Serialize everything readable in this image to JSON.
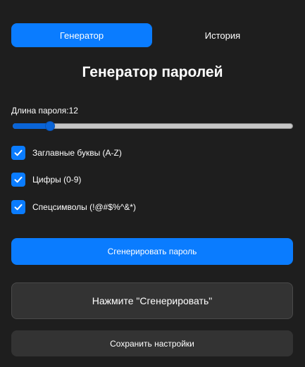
{
  "tabs": [
    {
      "label": "Генератор",
      "active": true
    },
    {
      "label": "История",
      "active": false
    }
  ],
  "title": "Генератор паролей",
  "length": {
    "label": "Длина пароля:",
    "value": "12",
    "min": 4,
    "max": 64
  },
  "options": [
    {
      "label": "Заглавные буквы (A-Z)",
      "checked": true
    },
    {
      "label": "Цифры (0-9)",
      "checked": true
    },
    {
      "label": "Спецсимволы (!@#$%^&*)",
      "checked": true
    }
  ],
  "generate_label": "Сгенерировать пароль",
  "result_placeholder": "Нажмите \"Сгенерировать\"",
  "save_label": "Сохранить настройки",
  "colors": {
    "background": "#1e1e1e",
    "accent": "#0a7cff",
    "panel": "#333333"
  },
  "icons": {
    "checkbox": "check-icon"
  }
}
